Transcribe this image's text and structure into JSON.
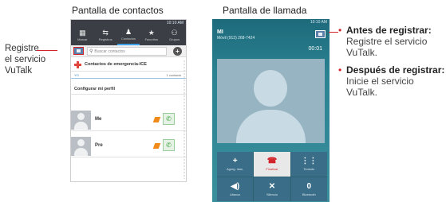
{
  "headings": {
    "contacts": "Pantalla de contactos",
    "call": "Pantalla de llamada"
  },
  "side_note": {
    "line1": "Registre",
    "line2": "el servicio",
    "line3": "VuTalk"
  },
  "colors": {
    "accent": "#d2232a",
    "call_bg": "#2b8291",
    "tab_highlight": "#3ea0e6"
  },
  "contacts_screen": {
    "status": "10:10 AM",
    "tabs": [
      {
        "label": "Marcar",
        "icon": "keypad-icon"
      },
      {
        "label": "Registros",
        "icon": "call-log-icon"
      },
      {
        "label": "Contactos",
        "icon": "contacts-icon"
      },
      {
        "label": "Favoritos",
        "icon": "star-icon"
      },
      {
        "label": "Grupos",
        "icon": "groups-icon"
      }
    ],
    "search_placeholder": "Buscar contactos",
    "ice_label": "Contactos de emergencia-ICE",
    "me_header": {
      "left": "YO",
      "right": "1 contacto"
    },
    "profile_label": "Configurar mi perfil",
    "contacts": [
      {
        "name": "Me"
      },
      {
        "name": "Pre"
      }
    ]
  },
  "call_screen": {
    "status": "10:10 AM",
    "name": "MI",
    "number": "Móvil (913) 268-7424",
    "timer": "00:01",
    "buttons": [
      {
        "label": "Agreg. llam.",
        "icon": "+"
      },
      {
        "label": "Finalizar",
        "icon": "☎"
      },
      {
        "label": "Teclado",
        "icon": "⋮⋮"
      },
      {
        "label": "Altavoz",
        "icon": "◀)"
      },
      {
        "label": "Silencio",
        "icon": "✕"
      },
      {
        "label": "Bluetooth",
        "icon": "0"
      }
    ]
  },
  "bullets": [
    {
      "title": "Antes de registrar:",
      "text": "Registre el servicio VuTalk."
    },
    {
      "title": "Después de registrar:",
      "text": "Inicie el servicio VuTalk."
    }
  ]
}
